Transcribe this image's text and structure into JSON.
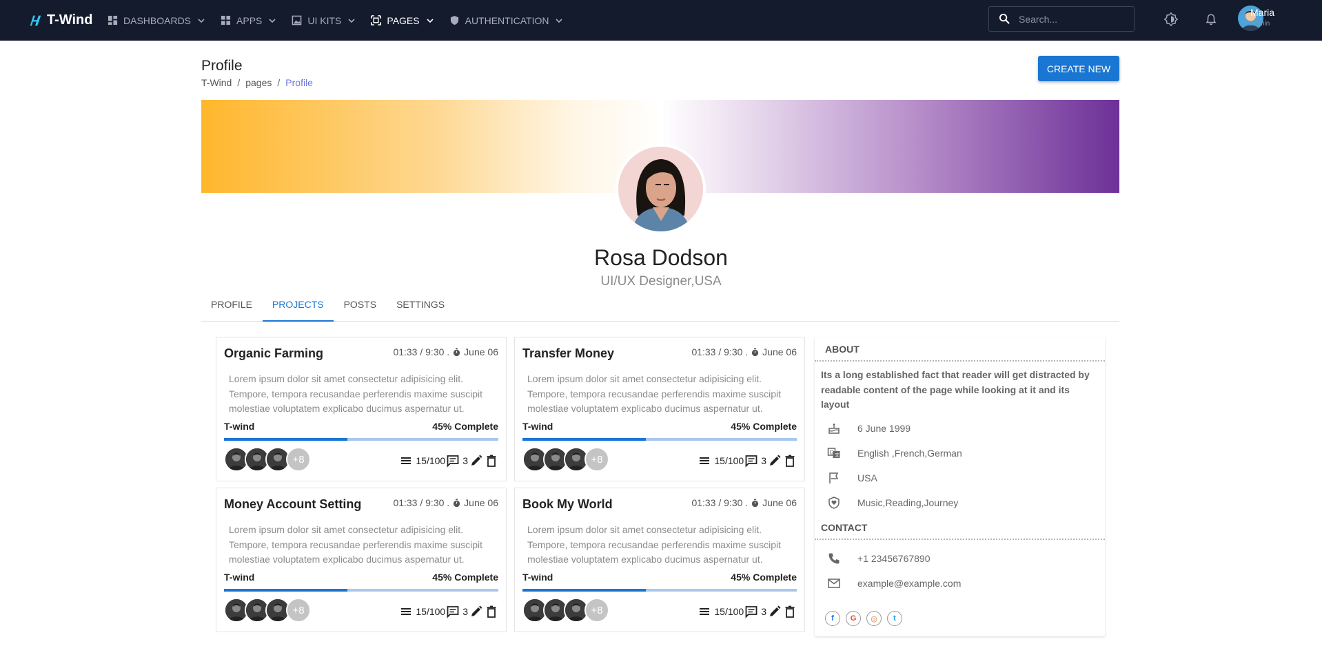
{
  "app": {
    "name": "T-Wind"
  },
  "nav": {
    "items": [
      {
        "label": "DASHBOARDS",
        "icon": "dashboard-icon"
      },
      {
        "label": "APPS",
        "icon": "apps-icon"
      },
      {
        "label": "UI KITS",
        "icon": "image-icon"
      },
      {
        "label": "PAGES",
        "icon": "pages-icon",
        "active": true
      },
      {
        "label": "AUTHENTICATION",
        "icon": "shield-icon"
      }
    ],
    "search_placeholder": "Search...",
    "user": {
      "name": "Maria",
      "role": "Admin"
    }
  },
  "page": {
    "title": "Profile",
    "breadcrumb": [
      "T-Wind",
      "pages",
      "Profile"
    ],
    "create_label": "CREATE NEW"
  },
  "profile": {
    "name": "Rosa Dodson",
    "role": "UI/UX Designer,USA"
  },
  "tabs": [
    "PROFILE",
    "PROJECTS",
    "POSTS",
    "SETTINGS"
  ],
  "active_tab": "PROJECTS",
  "projects": [
    {
      "title": "Organic Farming",
      "time": "01:33 / 9:30 .",
      "date": "June 06",
      "desc": "Lorem ipsum dolor sit amet consectetur adipisicing elit. Tempore, tempora recusandae perferendis maxime suscipit molestiae voluptatem explicabo ducimus aspernatur ut.",
      "org": "T-wind",
      "progress_label": "45% Complete",
      "progress": 0.45,
      "extra_members": "+8",
      "tasks": "15/100",
      "comments": "3"
    },
    {
      "title": "Transfer Money",
      "time": "01:33 / 9:30 .",
      "date": "June 06",
      "desc": "Lorem ipsum dolor sit amet consectetur adipisicing elit. Tempore, tempora recusandae perferendis maxime suscipit molestiae voluptatem explicabo ducimus aspernatur ut.",
      "org": "T-wind",
      "progress_label": "45% Complete",
      "progress": 0.45,
      "extra_members": "+8",
      "tasks": "15/100",
      "comments": "3"
    },
    {
      "title": "Money Account Setting",
      "time": "01:33 / 9:30 .",
      "date": "June 06",
      "desc": "Lorem ipsum dolor sit amet consectetur adipisicing elit. Tempore, tempora recusandae perferendis maxime suscipit molestiae voluptatem explicabo ducimus aspernatur ut.",
      "org": "T-wind",
      "progress_label": "45% Complete",
      "progress": 0.45,
      "extra_members": "+8",
      "tasks": "15/100",
      "comments": "3"
    },
    {
      "title": "Book My World",
      "time": "01:33 / 9:30 .",
      "date": "June 06",
      "desc": "Lorem ipsum dolor sit amet consectetur adipisicing elit. Tempore, tempora recusandae perferendis maxime suscipit molestiae voluptatem explicabo ducimus aspernatur ut.",
      "org": "T-wind",
      "progress_label": "45% Complete",
      "progress": 0.45,
      "extra_members": "+8",
      "tasks": "15/100",
      "comments": "3"
    }
  ],
  "about": {
    "title": "ABOUT",
    "text": "Its a long established fact that reader will get distracted by readable content of the page while looking at it and its layout",
    "birthday": "6 June 1999",
    "languages": "English ,French,German",
    "country": "USA",
    "interests": "Music,Reading,Journey"
  },
  "contact": {
    "title": "CONTACT",
    "phone": "+1 23456767890",
    "email": "example@example.com"
  },
  "socials": [
    {
      "name": "facebook",
      "glyph": "f",
      "color": "#1877f2"
    },
    {
      "name": "google",
      "glyph": "G",
      "color": "#ea4335"
    },
    {
      "name": "instagram",
      "glyph": "◎",
      "color": "#e1782f"
    },
    {
      "name": "twitter",
      "glyph": "t",
      "color": "#1da1f2"
    }
  ],
  "colors": {
    "topbar": "#141b2d",
    "accent": "#1976d2",
    "breadcrumb_current": "#6b76d8"
  }
}
